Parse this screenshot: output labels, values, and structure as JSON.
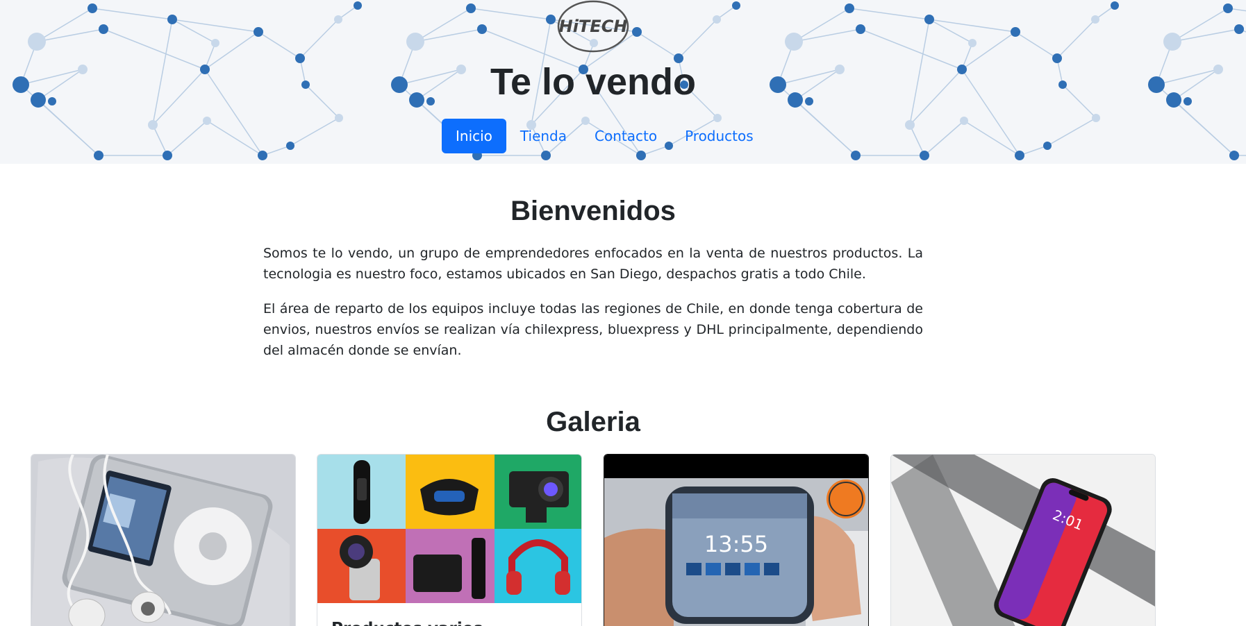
{
  "header": {
    "logo_text": "HiTECH",
    "site_title": "Te lo vendo",
    "nav": [
      {
        "label": "Inicio",
        "active": true
      },
      {
        "label": "Tienda",
        "active": false
      },
      {
        "label": "Contacto",
        "active": false
      },
      {
        "label": "Productos",
        "active": false
      }
    ]
  },
  "welcome": {
    "title": "Bienvenidos",
    "paragraphs": [
      "Somos te lo vendo, un grupo de emprendedores enfocados en la venta de nuestros productos. La tecnologia es nuestro foco, estamos ubicados en San Diego, despachos gratis a todo Chile.",
      "El área de reparto de los equipos incluye todas las regiones de Chile, en donde tenga cobertura de envios, nuestros envíos se realizan vía chilexpress, bluexpress y DHL principalmente, dependiendo del almacén donde se envían."
    ]
  },
  "gallery": {
    "title": "Galeria",
    "cards": [
      {
        "image": "ipod-classic-with-earphones",
        "title": ""
      },
      {
        "image": "product-collage",
        "title": "Productos varios"
      },
      {
        "image": "flexible-wrist-display",
        "title": ""
      },
      {
        "image": "iphone-x",
        "title": ""
      }
    ],
    "screen_time": "13:55",
    "phone_time": "2:01"
  },
  "colors": {
    "primary": "#0d6efd",
    "network_node": "#2f6fb5",
    "network_line": "#b9cde3"
  }
}
